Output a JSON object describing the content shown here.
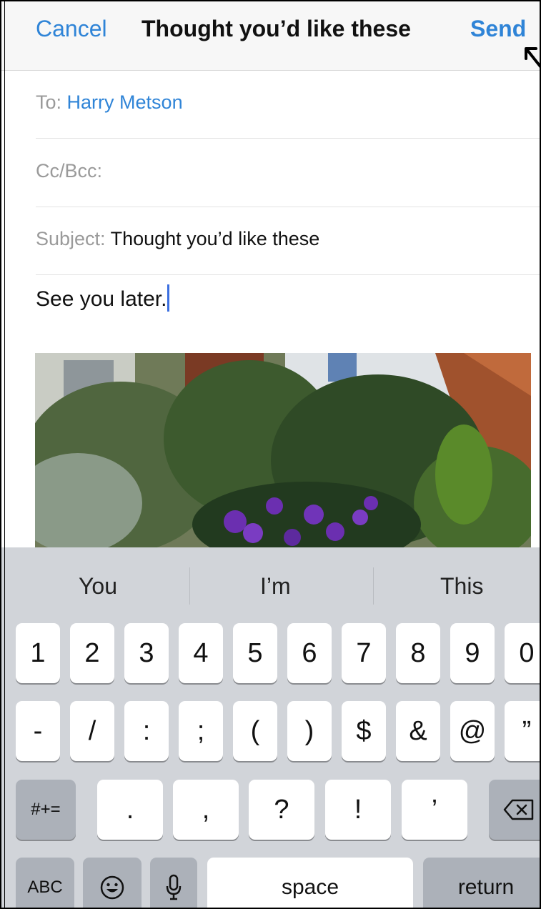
{
  "navbar": {
    "cancel_label": "Cancel",
    "title": "Thought you’d like these",
    "send_label": "Send"
  },
  "fields": {
    "to_label": "To:",
    "to_value": "Harry Metson",
    "ccbcc_label": "Cc/Bcc:",
    "subject_label": "Subject:",
    "subject_value": "Thought you’d like these"
  },
  "body": {
    "text": "See you later."
  },
  "keyboard": {
    "suggestions": [
      "You",
      "I’m",
      "This"
    ],
    "row1": [
      "1",
      "2",
      "3",
      "4",
      "5",
      "6",
      "7",
      "8",
      "9",
      "0"
    ],
    "row2": [
      "-",
      "/",
      ":",
      ";",
      "(",
      ")",
      "$",
      "&",
      "@",
      "”"
    ],
    "row3": {
      "toggle": "#+=",
      "keys": [
        ".",
        ",",
        "?",
        "!",
        "’"
      ],
      "delete_icon": "backspace-icon"
    },
    "row4": {
      "abc": "ABC",
      "emoji_icon": "emoji-icon",
      "mic_icon": "microphone-icon",
      "space": "space",
      "return": "return"
    }
  },
  "colors": {
    "accent": "#2f84d7",
    "keyboard_bg": "#d1d4d9",
    "dark_key": "#acb1b9",
    "caret": "#3b6fe0"
  }
}
